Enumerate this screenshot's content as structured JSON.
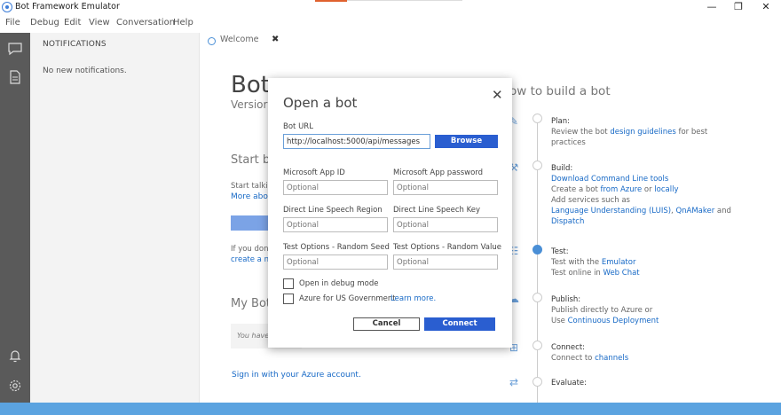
{
  "window": {
    "title": "Bot Framework Emulator",
    "minimize": "—",
    "maximize": "❐",
    "close": "✕"
  },
  "menu": [
    "File",
    "Debug",
    "Edit",
    "View",
    "Conversation",
    "Help"
  ],
  "notifications": {
    "heading": "NOTIFICATIONS",
    "empty": "No new notifications."
  },
  "tabs": [
    {
      "label": "Welcome",
      "close": "✖"
    }
  ],
  "welcome": {
    "title": "Bot",
    "version": "Versior",
    "start_heading": "Start by",
    "start_text": "Start talkin",
    "start_link": "More abou",
    "ifyou_text": "If you don'",
    "create_link": "create a ne",
    "mybots_heading": "My Bots",
    "mybots_empty": "You have",
    "signin_link": "Sign in with your Azure account."
  },
  "howto": {
    "title": "ow to build a bot",
    "steps": [
      {
        "title": "Plan:",
        "lines": [
          [
            "Review the bot ",
            "design guidelines",
            " for best"
          ],
          [
            "practices"
          ]
        ]
      },
      {
        "title": "Build:",
        "lines": [
          [
            "",
            "Download Command Line tools",
            ""
          ],
          [
            "Create a bot ",
            "from Azure",
            " or ",
            "locally"
          ],
          [
            "Add services such as"
          ],
          [
            "",
            "Language Understanding (LUIS)",
            ", ",
            "QnAMaker",
            " and"
          ],
          [
            "",
            "Dispatch",
            ""
          ]
        ]
      },
      {
        "title": "Test:",
        "lines": [
          [
            "Test with the ",
            "Emulator",
            ""
          ],
          [
            "Test online in ",
            "Web Chat",
            ""
          ]
        ]
      },
      {
        "title": "Publish:",
        "lines": [
          [
            "Publish directly to Azure or"
          ],
          [
            "Use ",
            "Continuous Deployment",
            ""
          ]
        ]
      },
      {
        "title": "Connect:",
        "lines": [
          [
            "Connect to ",
            "channels",
            ""
          ]
        ]
      },
      {
        "title": "Evaluate:",
        "lines": []
      }
    ]
  },
  "dialog": {
    "title": "Open a bot",
    "close": "✕",
    "bot_url": {
      "label": "Bot URL",
      "value": "http://localhost:5000/api/messages"
    },
    "browse": "Browse",
    "app_id": {
      "label": "Microsoft App ID",
      "placeholder": "Optional"
    },
    "app_password": {
      "label": "Microsoft App password",
      "placeholder": "Optional"
    },
    "speech_region": {
      "label": "Direct Line Speech Region",
      "placeholder": "Optional"
    },
    "speech_key": {
      "label": "Direct Line Speech Key",
      "placeholder": "Optional"
    },
    "random_seed": {
      "label": "Test Options - Random Seed",
      "placeholder": "Optional"
    },
    "random_value": {
      "label": "Test Options - Random Value",
      "placeholder": "Optional"
    },
    "debug_mode": {
      "label": "Open in debug mode",
      "checked": false
    },
    "azure_gov": {
      "label": "Azure for US Government",
      "link": "Learn more.",
      "checked": false
    },
    "cancel": "Cancel",
    "connect": "Connect"
  },
  "colors": {
    "accent": "#2a5ed0",
    "sidebar": "#5a5a5a",
    "statusbar": "#5ba3e0"
  }
}
